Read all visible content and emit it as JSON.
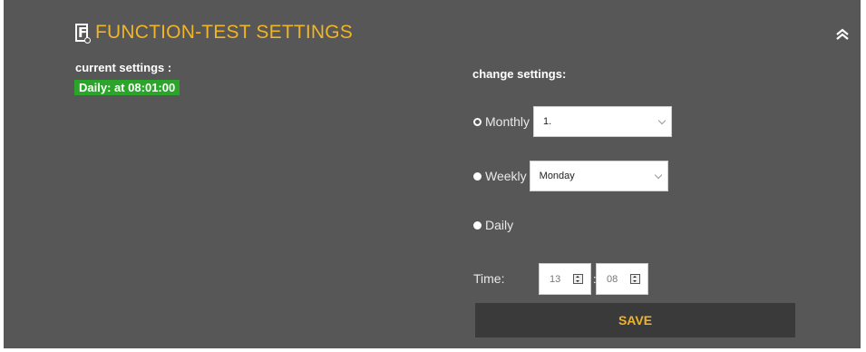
{
  "header": {
    "title": "FUNCTION-TEST SETTINGS",
    "logo_letter": "F",
    "logo_icon": "function-test-icon",
    "collapse_icon": "double-chevron-up-icon"
  },
  "current": {
    "label": "current settings :",
    "value": "Daily: at 08:01:00",
    "badge_color": "#2aa52a"
  },
  "change": {
    "label": "change settings:",
    "monthly": {
      "label": "Monthly",
      "selected": true,
      "value": "1."
    },
    "weekly": {
      "label": "Weekly",
      "selected": false,
      "value": "Monday"
    },
    "daily": {
      "label": "Daily",
      "selected": false
    }
  },
  "time": {
    "label": "Time:",
    "hour": "13",
    "separator": ":",
    "minute": "08"
  },
  "save_label": "SAVE",
  "colors": {
    "panel": "#575757",
    "accent": "#f0b428",
    "button": "#3a3a3a"
  }
}
